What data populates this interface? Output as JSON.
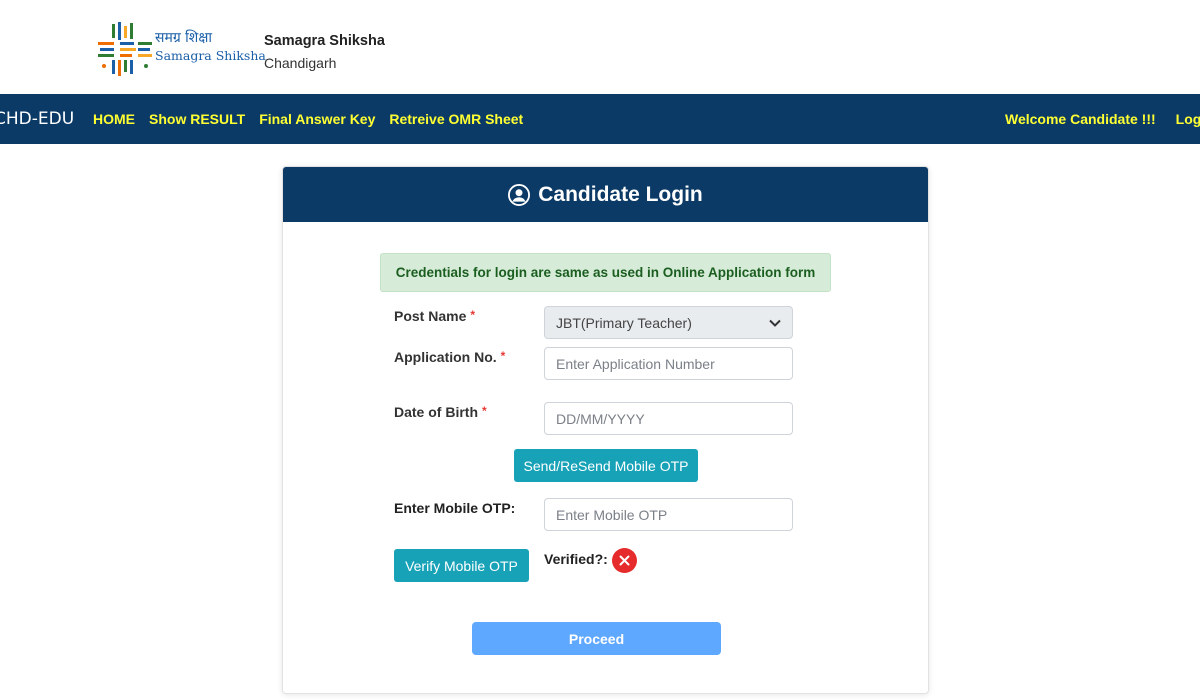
{
  "header": {
    "logo_hindi": "समग्र शिक्षा",
    "logo_english": "Samagra Shiksha",
    "org_name": "Samagra Shiksha",
    "org_city": "Chandigarh"
  },
  "nav": {
    "brand": "CHD-EDU",
    "links": [
      "HOME",
      "Show RESULT",
      "Final Answer Key",
      "Retreive OMR Sheet"
    ],
    "welcome": "Welcome Candidate !!!",
    "login": "Login"
  },
  "card": {
    "title": "Candidate Login",
    "notice": "Credentials for login are same as used in Online Application form",
    "post_name": {
      "label": "Post Name",
      "required_mark": "*",
      "selected": "JBT(Primary Teacher)"
    },
    "application_no": {
      "label": "Application No.",
      "required_mark": "*",
      "placeholder": "Enter Application Number"
    },
    "dob": {
      "label": "Date of Birth",
      "required_mark": "*",
      "placeholder": "DD/MM/YYYY"
    },
    "send_otp_label": "Send/ReSend Mobile OTP",
    "otp": {
      "label": "Enter Mobile OTP:",
      "placeholder": "Enter Mobile OTP"
    },
    "verify_label": "Verify Mobile OTP",
    "verified_label": "Verified?:",
    "proceed_label": "Proceed"
  },
  "colors": {
    "nav_bg": "#0b3a66",
    "nav_link": "#ffff33",
    "teal_button": "#17a2b8",
    "proceed_button": "#5fa8ff",
    "notice_bg": "#d6ecd8",
    "error_red": "#e52b2b"
  }
}
